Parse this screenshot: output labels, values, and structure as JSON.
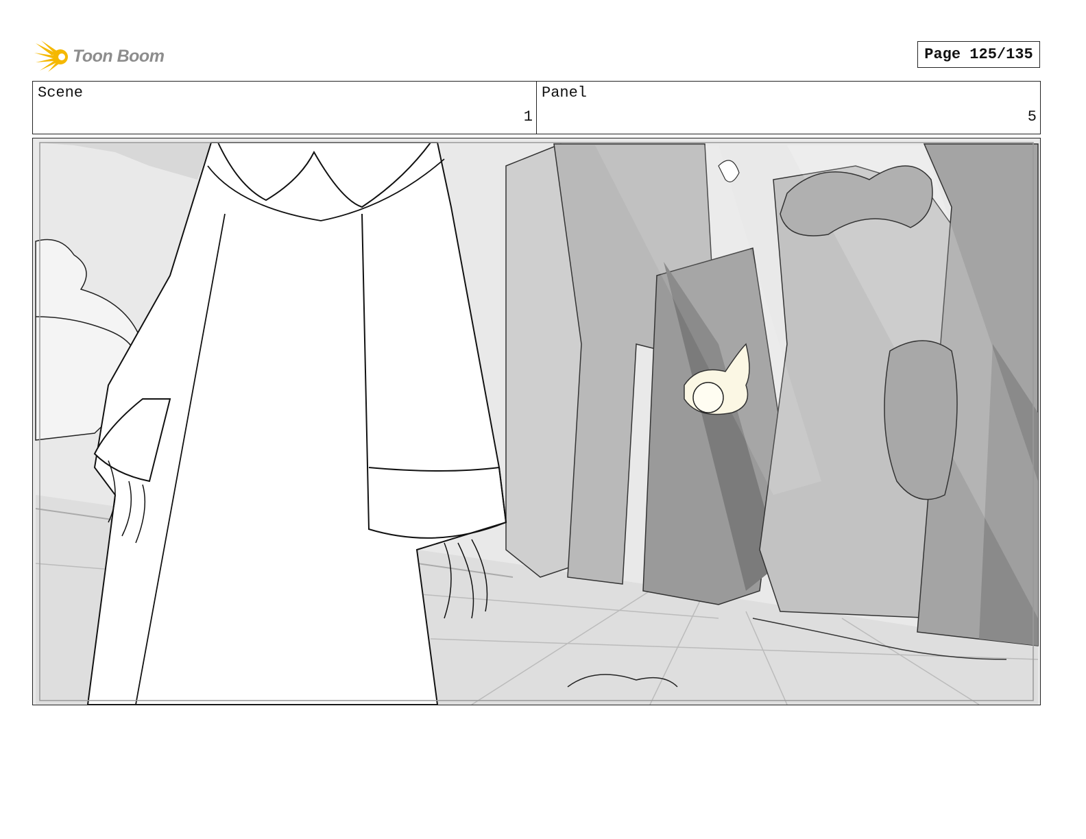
{
  "logo": {
    "text": "Toon Boom",
    "icon": "toon-boom-burst-icon",
    "color": "#f5b800"
  },
  "page": {
    "label": "Page 125/135"
  },
  "header": {
    "scene_label": "Scene",
    "scene_value": "1",
    "panel_label": "Panel",
    "panel_value": "5"
  },
  "panel_image": {
    "icon": "storyboard-drawing"
  }
}
